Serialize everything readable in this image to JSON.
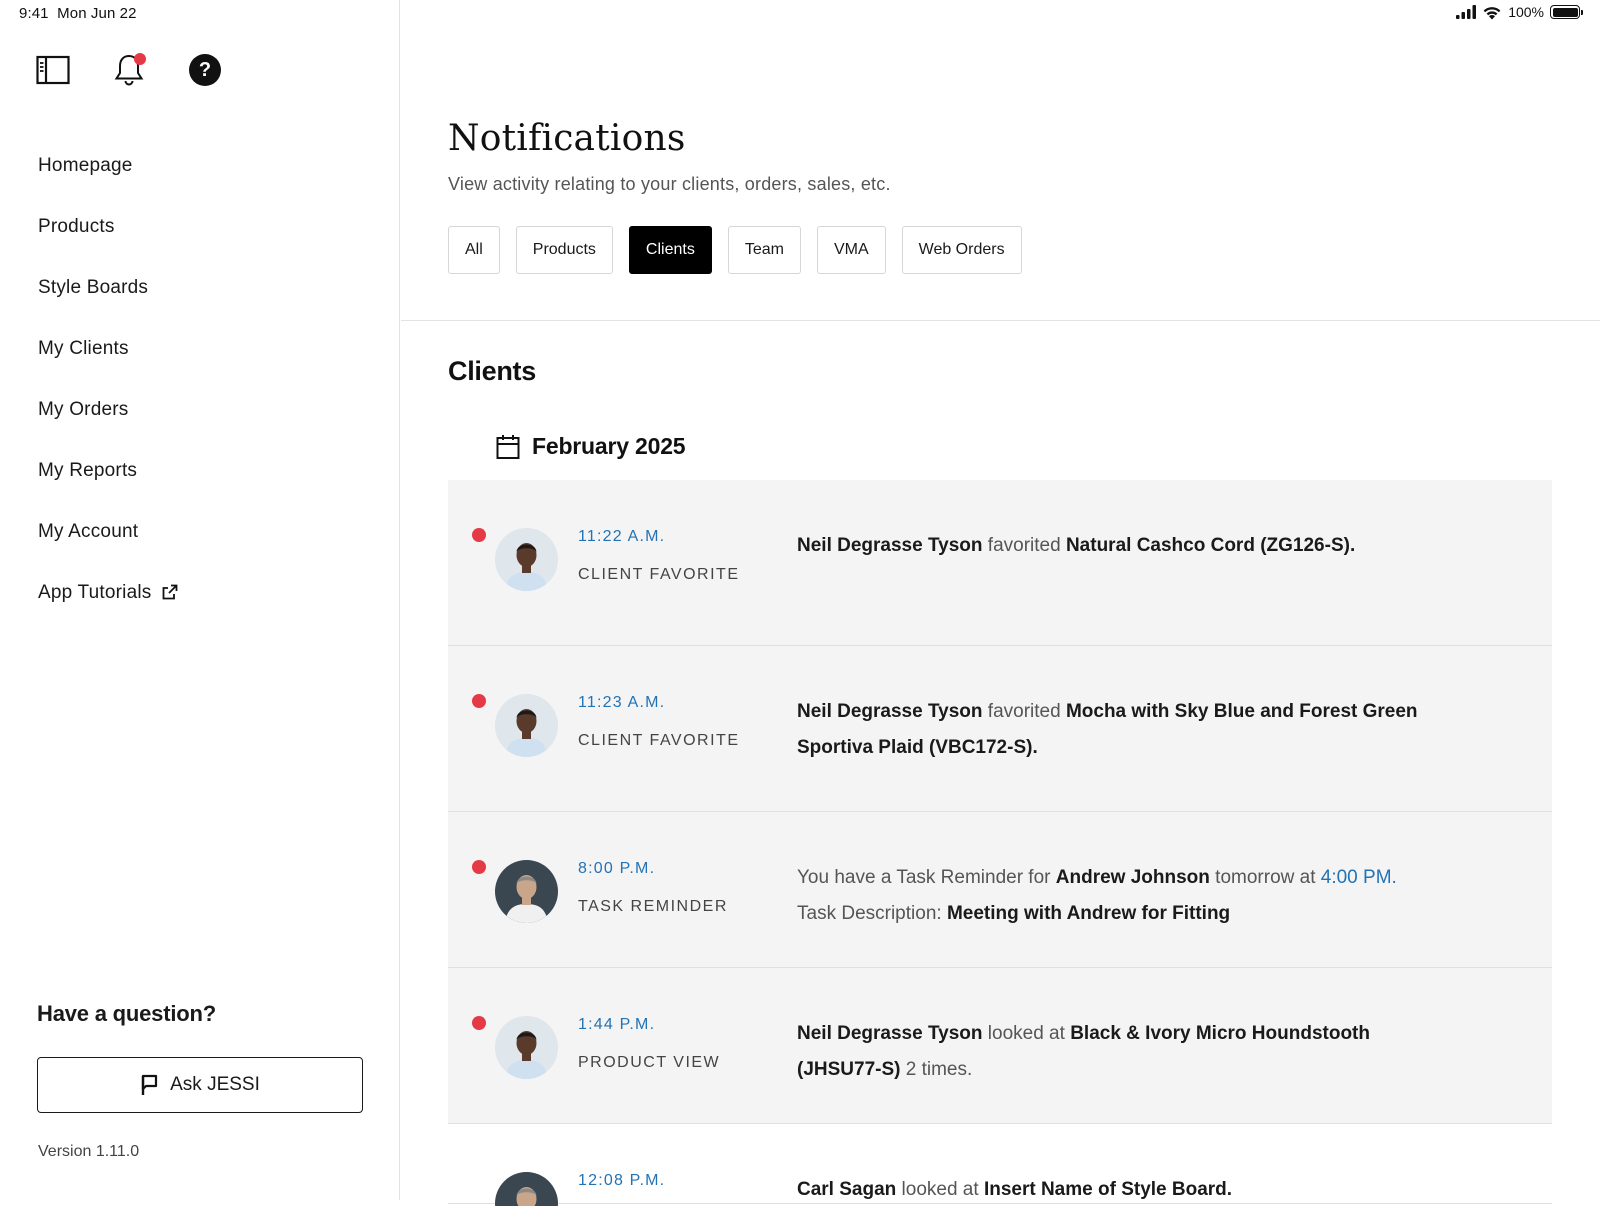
{
  "status_bar": {
    "time": "9:41",
    "date": "Mon Jun 22",
    "battery": "100%"
  },
  "sidebar": {
    "nav": [
      {
        "label": "Homepage"
      },
      {
        "label": "Products"
      },
      {
        "label": "Style Boards"
      },
      {
        "label": "My Clients"
      },
      {
        "label": "My Orders"
      },
      {
        "label": "My Reports"
      },
      {
        "label": "My Account"
      },
      {
        "label": "App Tutorials",
        "external": true
      }
    ],
    "question": "Have a question?",
    "ask_button": "Ask JESSI",
    "version": "Version 1.11.0"
  },
  "header": {
    "title": "Notifications",
    "subtitle": "View activity relating to your clients, orders, sales, etc.",
    "filters": [
      {
        "label": "All",
        "active": false
      },
      {
        "label": "Products",
        "active": false
      },
      {
        "label": "Clients",
        "active": true
      },
      {
        "label": "Team",
        "active": false
      },
      {
        "label": "VMA",
        "active": false
      },
      {
        "label": "Web Orders",
        "active": false
      }
    ]
  },
  "section": {
    "title": "Clients",
    "month": "February 2025"
  },
  "notifications": [
    {
      "time": "11:22 A.M.",
      "type": "CLIENT FAVORITE",
      "unread": true,
      "parts": [
        {
          "t": "Neil Degrasse Tyson",
          "s": "b"
        },
        {
          "t": " favorited ",
          "s": "n"
        },
        {
          "t": "Natural Cashco Cord (ZG126-S).",
          "s": "b"
        }
      ]
    },
    {
      "time": "11:23 A.M.",
      "type": "CLIENT FAVORITE",
      "unread": true,
      "parts": [
        {
          "t": "Neil Degrasse Tyson",
          "s": "b"
        },
        {
          "t": " favorited ",
          "s": "n"
        },
        {
          "t": "Mocha with Sky Blue and Forest Green Sportiva Plaid (VBC172-S).",
          "s": "b"
        }
      ]
    },
    {
      "time": "8:00 P.M.",
      "type": "TASK REMINDER",
      "unread": true,
      "parts": [
        {
          "t": "You have a Task Reminder for ",
          "s": "n"
        },
        {
          "t": "Andrew Johnson",
          "s": "b"
        },
        {
          "t": " tomorrow at ",
          "s": "n"
        },
        {
          "t": "4:00 PM.",
          "s": "l"
        },
        {
          "t": "\n",
          "s": "br"
        },
        {
          "t": "Task Description: ",
          "s": "n"
        },
        {
          "t": "Meeting with Andrew for Fitting",
          "s": "b"
        }
      ]
    },
    {
      "time": "1:44 P.M.",
      "type": "PRODUCT VIEW",
      "unread": true,
      "parts": [
        {
          "t": "Neil Degrasse Tyson",
          "s": "b"
        },
        {
          "t": " looked at ",
          "s": "n"
        },
        {
          "t": "Black & Ivory Micro Houndstooth (JHSU77-S)",
          "s": "b"
        },
        {
          "t": " 2 times.",
          "s": "n"
        }
      ]
    },
    {
      "time": "12:08 P.M.",
      "type": "",
      "unread": false,
      "parts": [
        {
          "t": "Carl Sagan",
          "s": "b"
        },
        {
          "t": " looked at ",
          "s": "n"
        },
        {
          "t": "Insert Name of Style Board.",
          "s": "b"
        }
      ]
    }
  ]
}
